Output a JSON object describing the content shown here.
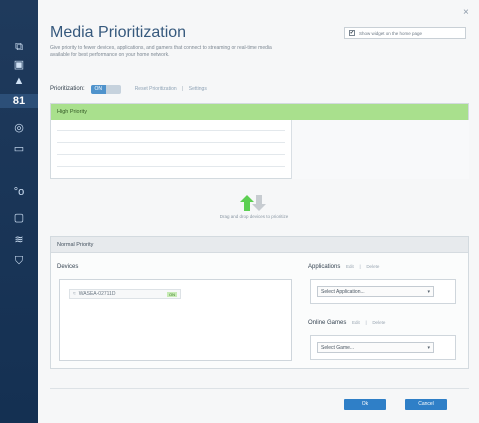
{
  "window": {
    "close_glyph": "×"
  },
  "sidebar": {
    "items": [
      {
        "name": "network-map-icon",
        "glyph": "⧉"
      },
      {
        "name": "router-icon",
        "glyph": "▣"
      },
      {
        "name": "alert-icon",
        "glyph": "▲"
      },
      {
        "name": "media-prioritization-icon",
        "glyph": "81",
        "active": true
      },
      {
        "name": "globe-icon",
        "glyph": "◎"
      },
      {
        "name": "card-icon",
        "glyph": "▭"
      },
      {
        "name": "settings-icon",
        "glyph": "°o"
      },
      {
        "name": "monitor-icon",
        "glyph": "▢"
      },
      {
        "name": "wifi-icon",
        "glyph": "≋"
      },
      {
        "name": "shield-icon",
        "glyph": "⛉"
      }
    ]
  },
  "header": {
    "title": "Media Prioritization",
    "description": "Give priority to fewer devices, applications, and gamers that connect to streaming or real-time media available for best performance on your home network.",
    "show_widget_label": "Show widget on the home page",
    "show_widget_checked": true
  },
  "prioritization": {
    "label": "Prioritization:",
    "toggle_on": "ON",
    "reset_link": "Reset Prioritization",
    "separator": "|",
    "settings_link": "Settings"
  },
  "high_priority": {
    "title": "High Priority"
  },
  "drag_hint": "Drag and drop devices to prioritize",
  "normal_priority": {
    "title": "Normal Priority",
    "devices_label": "Devices",
    "device": {
      "name": "WASEA-02711D",
      "badge": "ON",
      "icon": "wifi-device-icon"
    }
  },
  "applications": {
    "label": "Applications",
    "edit": "Edit",
    "sep": "|",
    "delete": "Delete",
    "select_placeholder": "Select Application...",
    "caret": "▾"
  },
  "online_games": {
    "label": "Online Games",
    "edit": "Edit",
    "sep": "|",
    "delete": "Delete",
    "select_placeholder": "Select Game...",
    "caret": "▾"
  },
  "footer": {
    "ok": "Ok",
    "cancel": "Cancel"
  }
}
